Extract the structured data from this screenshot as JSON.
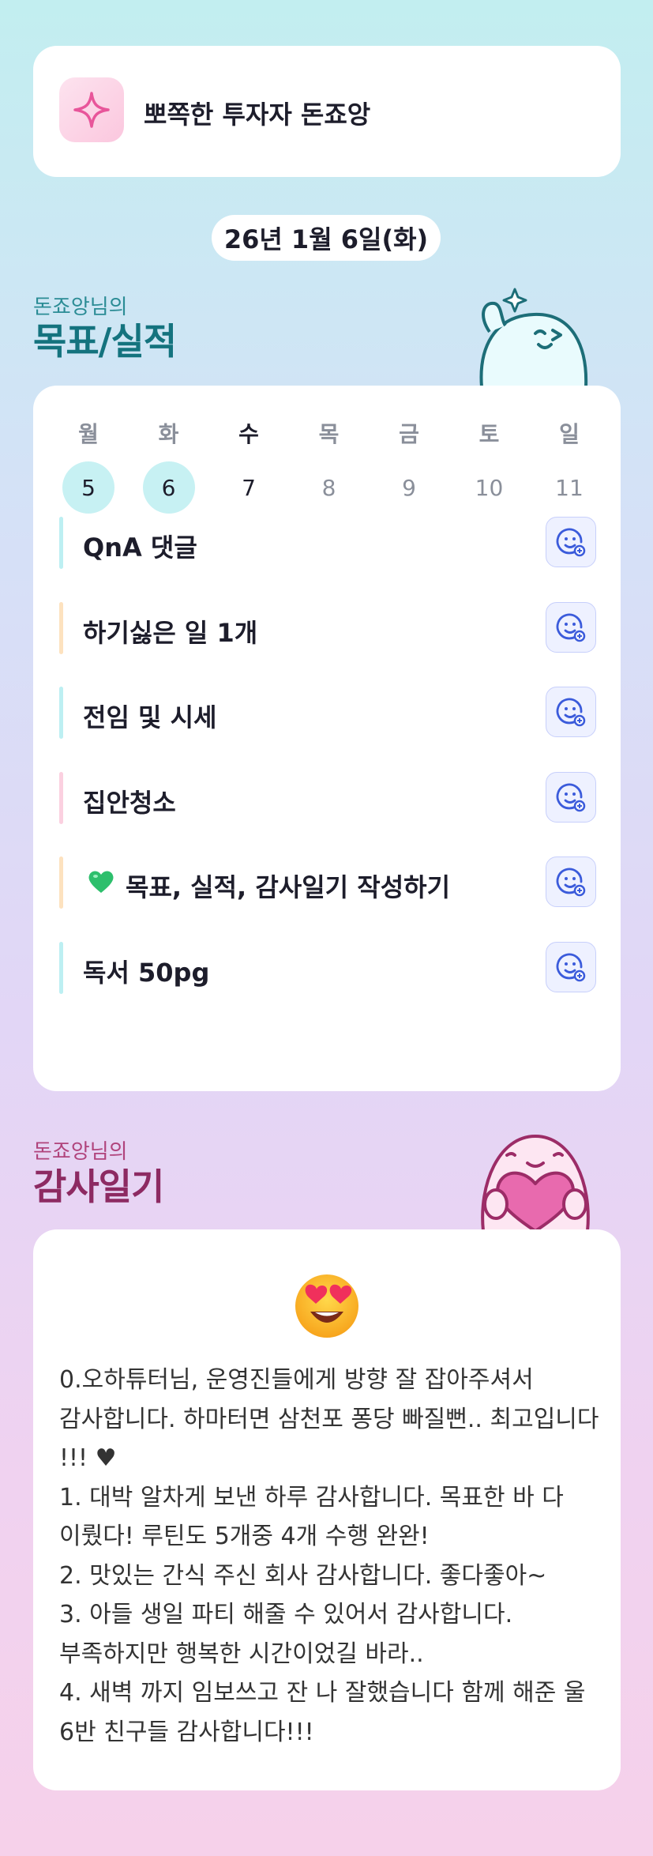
{
  "profile": {
    "name": "뽀쪽한 투자자 돈죠앙",
    "icon": "sparkle-icon"
  },
  "date": "26년 1월 6일(화)",
  "goals_section": {
    "subtitle": "돈죠앙님의",
    "title": "목표/실적"
  },
  "week": [
    {
      "label": "월",
      "num": "5",
      "state": "done"
    },
    {
      "label": "화",
      "num": "6",
      "state": "done"
    },
    {
      "label": "수",
      "num": "7",
      "state": "today"
    },
    {
      "label": "목",
      "num": "8",
      "state": "future"
    },
    {
      "label": "금",
      "num": "9",
      "state": "future"
    },
    {
      "label": "토",
      "num": "10",
      "state": "future"
    },
    {
      "label": "일",
      "num": "11",
      "state": "future"
    }
  ],
  "goals": [
    {
      "text": "QnA 댓글",
      "color": "#bdeff2",
      "icon": "smile-add-icon"
    },
    {
      "text": "하기싫은 일 1개",
      "color": "#fde2bf",
      "icon": "smile-add-icon"
    },
    {
      "text": "전임 및 시세",
      "color": "#bdeff2",
      "icon": "smile-add-icon"
    },
    {
      "text": "집안청소",
      "color": "#fbd0e0",
      "icon": "smile-add-icon"
    },
    {
      "text": "목표, 실적, 감사일기 작성하기",
      "color": "#fde2bf",
      "icon": "smile-add-icon",
      "prefix_icon": "green-heart-icon"
    },
    {
      "text": "독서 50pg",
      "color": "#bdeff2",
      "icon": "smile-add-icon"
    }
  ],
  "thanks_section": {
    "subtitle": "돈죠앙님의",
    "title": "감사일기"
  },
  "thanks": {
    "emoji": "heart-eyes-emoji",
    "text": "0.오하튜터님, 운영진들에게 방향 잘 잡아주셔서 감사합니다. 하마터면 삼천포 퐁당 빠질뻔.. 최고입니다 !!! ♥\n1. 대박 알차게 보낸 하루 감사합니다. 목표한 바 다 이뤘다! 루틴도 5개중 4개 수행 완완!\n2. 맛있는 간식 주신 회사 감사합니다. 좋다좋아~\n3. 아들 생일 파티 해줄 수 있어서 감사합니다. 부족하지만 행복한 시간이었길 바라..\n4. 새벽 까지 임보쓰고 잔 나 잘했습니다 함께 해준 울 6반 친구들 감사합니다!!!"
  },
  "colors": {
    "goals_accent": "#14737e",
    "thanks_accent": "#8d2a62",
    "done_day": "#c7f1f3",
    "button_bg": "#eef1ff",
    "button_icon": "#3b5bdb"
  }
}
